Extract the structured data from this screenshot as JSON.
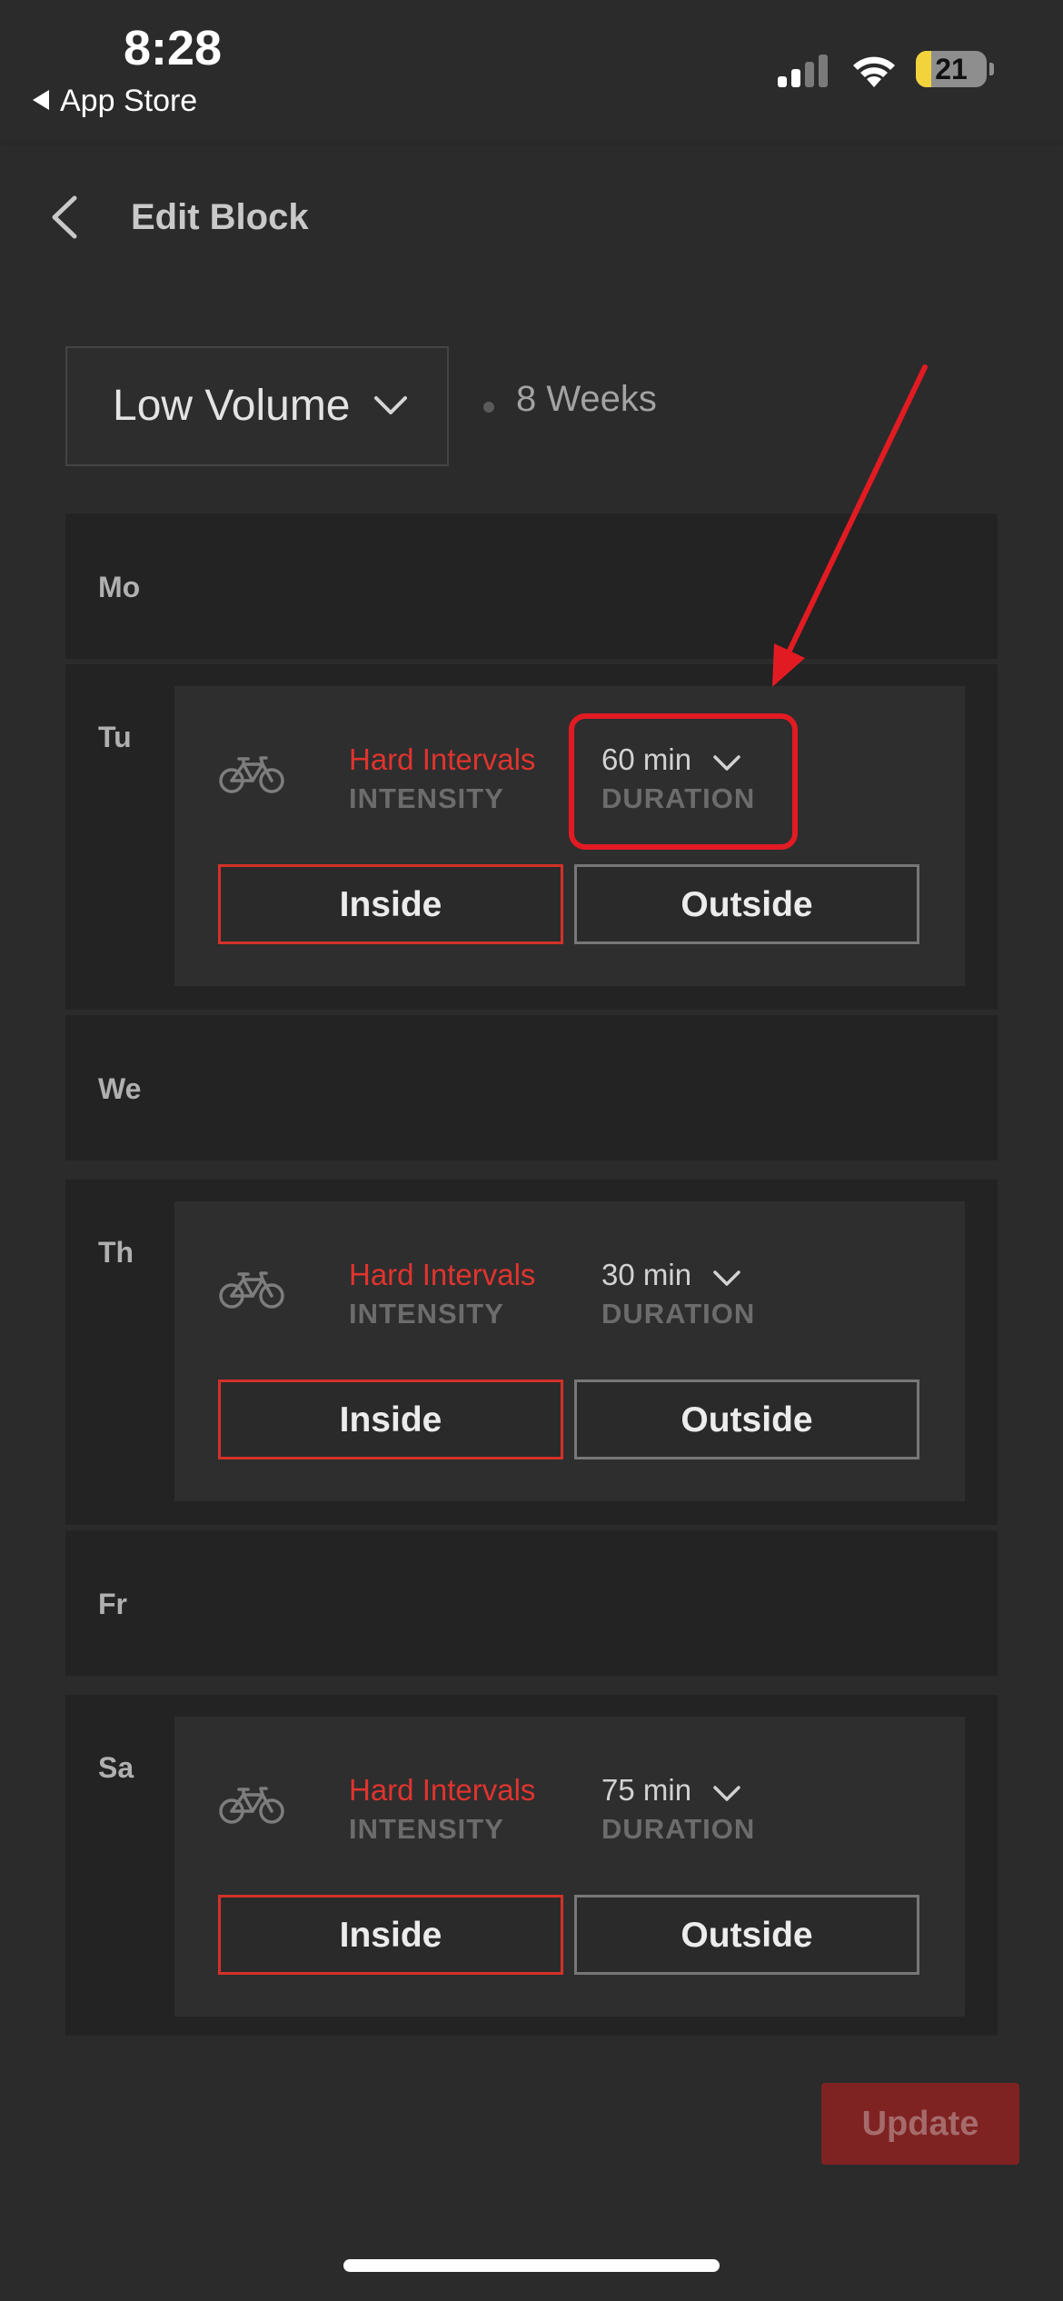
{
  "status_bar": {
    "time": "8:28",
    "back_app": "App Store",
    "battery": "21"
  },
  "header": {
    "title": "Edit Block"
  },
  "plan": {
    "volume": "Low Volume",
    "weeks": "8 Weeks"
  },
  "days": [
    {
      "label": "Mo"
    },
    {
      "label": "Tu",
      "intensity": "Hard Intervals",
      "intensity_caption": "INTENSITY",
      "duration": "60 min",
      "duration_caption": "DURATION",
      "inside": "Inside",
      "outside": "Outside"
    },
    {
      "label": "We"
    },
    {
      "label": "Th",
      "intensity": "Hard Intervals",
      "intensity_caption": "INTENSITY",
      "duration": "30 min",
      "duration_caption": "DURATION",
      "inside": "Inside",
      "outside": "Outside"
    },
    {
      "label": "Fr"
    },
    {
      "label": "Sa",
      "intensity": "Hard Intervals",
      "intensity_caption": "INTENSITY",
      "duration": "75 min",
      "duration_caption": "DURATION",
      "inside": "Inside",
      "outside": "Outside"
    }
  ],
  "footer": {
    "update_label": "Update"
  },
  "colors": {
    "accent_red": "#e0342e",
    "annotation_red": "#e21b23",
    "background": "#2b2b2b"
  }
}
